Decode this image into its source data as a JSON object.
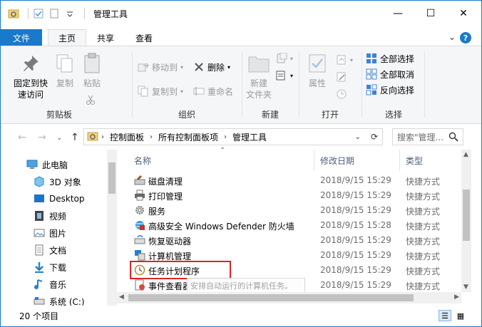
{
  "window": {
    "title": "管理工具",
    "minimize_glyph": "—",
    "maximize_glyph": "☐",
    "close_glyph": "✕"
  },
  "tabs": {
    "file": "文件",
    "home": "主页",
    "share": "共享",
    "view": "查看",
    "help_glyph": "?",
    "collapse_glyph": "⌄"
  },
  "ribbon": {
    "clipboard": {
      "label": "剪贴板",
      "pin_line1": "固定到快",
      "pin_line2": "速访问",
      "copy": "复制",
      "paste": "粘贴"
    },
    "organize": {
      "label": "组织",
      "move_to": "移动到",
      "copy_to": "复制到",
      "delete": "删除",
      "rename": "重命名"
    },
    "new": {
      "label": "新建",
      "new_folder_line1": "新建",
      "new_folder_line2": "文件夹"
    },
    "open": {
      "label": "打开",
      "properties": "属性"
    },
    "select": {
      "label": "选择",
      "select_all": "全部选择",
      "select_none": "全部取消",
      "invert": "反向选择"
    }
  },
  "address": {
    "crumbs": [
      "控制面板",
      "所有控制面板项",
      "管理工具"
    ],
    "search_placeholder": "搜索\"管理..."
  },
  "nav": {
    "items": [
      {
        "label": "此电脑",
        "icon": "computer-icon"
      },
      {
        "label": "3D 对象",
        "icon": "3d-objects-icon"
      },
      {
        "label": "Desktop",
        "icon": "desktop-icon"
      },
      {
        "label": "视频",
        "icon": "video-icon"
      },
      {
        "label": "图片",
        "icon": "pictures-icon"
      },
      {
        "label": "文档",
        "icon": "documents-icon"
      },
      {
        "label": "下载",
        "icon": "download-icon"
      },
      {
        "label": "音乐",
        "icon": "music-icon"
      },
      {
        "label": "系统 (C:)",
        "icon": "drive-icon"
      }
    ]
  },
  "columns": {
    "name": "名称",
    "date": "修改日期",
    "type": "类型"
  },
  "files": [
    {
      "name": "磁盘清理",
      "date": "2018/9/15 15:29",
      "type": "快捷方式",
      "icon": "disk-cleanup-icon"
    },
    {
      "name": "打印管理",
      "date": "2018/9/15 15:29",
      "type": "快捷方式",
      "icon": "printer-icon"
    },
    {
      "name": "服务",
      "date": "2018/9/15 15:29",
      "type": "快捷方式",
      "icon": "services-gear-icon"
    },
    {
      "name": "高级安全 Windows Defender 防火墙",
      "date": "2018/9/15 15:28",
      "type": "快捷方式",
      "icon": "firewall-icon"
    },
    {
      "name": "恢复驱动器",
      "date": "2018/9/15 15:29",
      "type": "快捷方式",
      "icon": "recovery-drive-icon"
    },
    {
      "name": "计算机管理",
      "date": "2018/9/15 15:29",
      "type": "快捷方式",
      "icon": "computer-management-icon"
    },
    {
      "name": "任务计划程序",
      "date": "2018/9/15 15:29",
      "type": "快捷方式",
      "icon": "task-scheduler-clock-icon"
    },
    {
      "name": "事件查看器",
      "date": "2018/9/15 15:29",
      "type": "快捷方式",
      "icon": "event-viewer-icon"
    }
  ],
  "tooltip": "安排自动运行的计算机任务。",
  "status": {
    "count": "20 个项目"
  }
}
